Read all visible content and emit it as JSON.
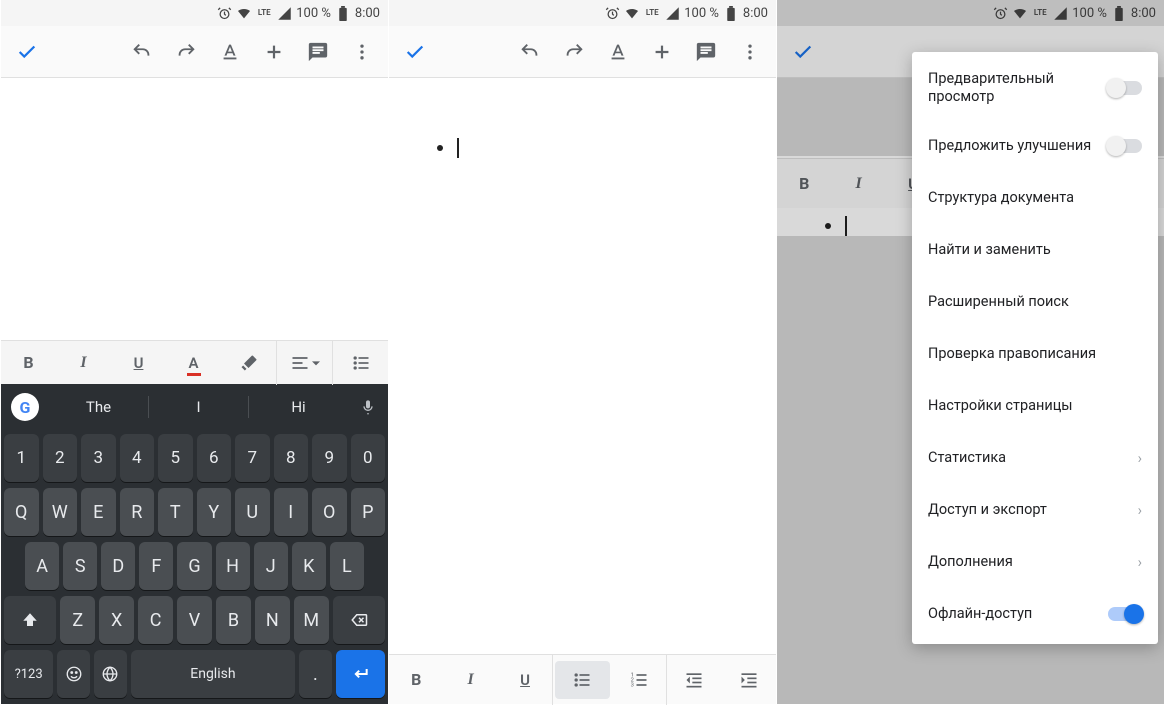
{
  "status": {
    "time": "8:00",
    "battery_text": "100 %",
    "lte": "LTE"
  },
  "toolbar": {
    "done": "done",
    "undo": "undo",
    "redo": "redo",
    "format": "format",
    "insert": "insert",
    "comment": "comment",
    "overflow": "more"
  },
  "format1": {
    "bold": "B",
    "italic": "I",
    "underline": "U",
    "textcolor": "A"
  },
  "suggest": {
    "s1": "The",
    "s2": "I",
    "s3": "Hi"
  },
  "keyboard": {
    "row_num": [
      "1",
      "2",
      "3",
      "4",
      "5",
      "6",
      "7",
      "8",
      "9",
      "0"
    ],
    "row1": [
      "Q",
      "W",
      "E",
      "R",
      "T",
      "Y",
      "U",
      "I",
      "O",
      "P"
    ],
    "row2": [
      "A",
      "S",
      "D",
      "F",
      "G",
      "H",
      "J",
      "K",
      "L"
    ],
    "row3": [
      "Z",
      "X",
      "C",
      "V",
      "B",
      "N",
      "M"
    ],
    "sym": "?123",
    "lang": "English"
  },
  "menu": {
    "preview": "Предварительный просмотр",
    "suggest": "Предложить улучшения",
    "outline": "Структура документа",
    "find": "Найти и заменить",
    "advsearch": "Расширенный поиск",
    "spell": "Проверка правописания",
    "pagesetup": "Настройки страницы",
    "stats": "Статистика",
    "share": "Доступ и экспорт",
    "addons": "Дополнения",
    "offline": "Офлайн-доступ"
  }
}
